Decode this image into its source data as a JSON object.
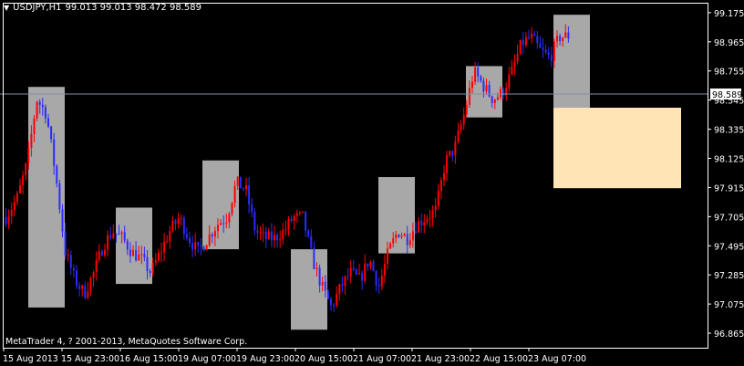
{
  "window": {
    "symbol": "USDJPY,H1",
    "ohlc": "99.013 99.013 98.472 98.589",
    "copyright": "MetaTrader 4, ? 2001-2013, MetaQuotes Software Corp."
  },
  "colors": {
    "background": "#000000",
    "bull_candle": "#ff0000",
    "bear_candle": "#2b2bff",
    "zone_gray": "#a8a8a8",
    "zone_orange": "#ffe4b5",
    "bid_line": "#8090a8",
    "axis": "#ffffff"
  },
  "chart_data": {
    "type": "candlestick",
    "symbol": "USDJPY",
    "timeframe": "H1",
    "current_price": "98.589",
    "ylim": [
      96.76,
      99.24
    ],
    "y_ticks": [
      "99.175",
      "98.965",
      "98.755",
      "98.545",
      "98.335",
      "98.125",
      "97.915",
      "97.705",
      "97.495",
      "97.285",
      "97.075",
      "96.865"
    ],
    "x_ticks": [
      "15 Aug 2013",
      "15 Aug 23:00",
      "16 Aug 15:00",
      "19 Aug 07:00",
      "19 Aug 23:00",
      "20 Aug 15:00",
      "21 Aug 07:00",
      "21 Aug 23:00",
      "22 Aug 15:00",
      "23 Aug 07:00"
    ],
    "candle_count": 200,
    "path_keypoints": [
      [
        0,
        97.7
      ],
      [
        5,
        97.85
      ],
      [
        9,
        98.1
      ],
      [
        13,
        98.55
      ],
      [
        17,
        98.45
      ],
      [
        21,
        98.0
      ],
      [
        25,
        97.45
      ],
      [
        29,
        97.25
      ],
      [
        33,
        97.15
      ],
      [
        37,
        97.3
      ],
      [
        41,
        97.5
      ],
      [
        45,
        97.6
      ],
      [
        49,
        97.55
      ],
      [
        53,
        97.45
      ],
      [
        57,
        97.4
      ],
      [
        61,
        97.3
      ],
      [
        65,
        97.45
      ],
      [
        69,
        97.6
      ],
      [
        73,
        97.7
      ],
      [
        77,
        97.55
      ],
      [
        81,
        97.45
      ],
      [
        85,
        97.55
      ],
      [
        89,
        97.65
      ],
      [
        93,
        97.7
      ],
      [
        97,
        97.95
      ],
      [
        101,
        97.9
      ],
      [
        105,
        97.6
      ],
      [
        109,
        97.55
      ],
      [
        113,
        97.55
      ],
      [
        117,
        97.6
      ],
      [
        121,
        97.7
      ],
      [
        125,
        97.7
      ],
      [
        129,
        97.4
      ],
      [
        133,
        97.2
      ],
      [
        137,
        97.05
      ],
      [
        141,
        97.2
      ],
      [
        145,
        97.3
      ],
      [
        149,
        97.25
      ],
      [
        153,
        97.4
      ],
      [
        157,
        97.2
      ],
      [
        161,
        97.45
      ],
      [
        165,
        97.6
      ],
      [
        169,
        97.55
      ],
      [
        173,
        97.65
      ],
      [
        177,
        97.7
      ],
      [
        181,
        97.75
      ],
      [
        185,
        98.1
      ],
      [
        189,
        98.2
      ],
      [
        193,
        98.45
      ],
      [
        197,
        98.75
      ],
      [
        201,
        98.65
      ],
      [
        205,
        98.55
      ],
      [
        209,
        98.6
      ],
      [
        213,
        98.75
      ],
      [
        217,
        98.95
      ],
      [
        221,
        99.0
      ],
      [
        225,
        98.9
      ],
      [
        229,
        98.85
      ],
      [
        233,
        99.0
      ],
      [
        238,
        99.01
      ]
    ],
    "zones": [
      {
        "label": "",
        "color": "gray",
        "x0": 31,
        "x1": 71,
        "y_top": 98.64,
        "y_bottom": 97.05
      },
      {
        "label": "",
        "color": "gray",
        "x0": 127,
        "x1": 167,
        "y_top": 97.77,
        "y_bottom": 97.22
      },
      {
        "label": "",
        "color": "gray",
        "x0": 222,
        "x1": 262,
        "y_top": 98.11,
        "y_bottom": 97.47
      },
      {
        "label": "",
        "color": "gray",
        "x0": 319,
        "x1": 359,
        "y_top": 97.47,
        "y_bottom": 96.89
      },
      {
        "label": "",
        "color": "gray",
        "x0": 415,
        "x1": 455,
        "y_top": 97.99,
        "y_bottom": 97.44
      },
      {
        "label": "",
        "color": "gray",
        "x0": 511,
        "x1": 551,
        "y_top": 98.79,
        "y_bottom": 98.42
      },
      {
        "label": "",
        "color": "gray",
        "x0": 607,
        "x1": 647,
        "y_top": 99.16,
        "y_bottom": 98.49
      },
      {
        "label": "",
        "color": "orange",
        "x0": 607,
        "x1": 747,
        "y_top": 98.49,
        "y_bottom": 97.91
      }
    ]
  }
}
